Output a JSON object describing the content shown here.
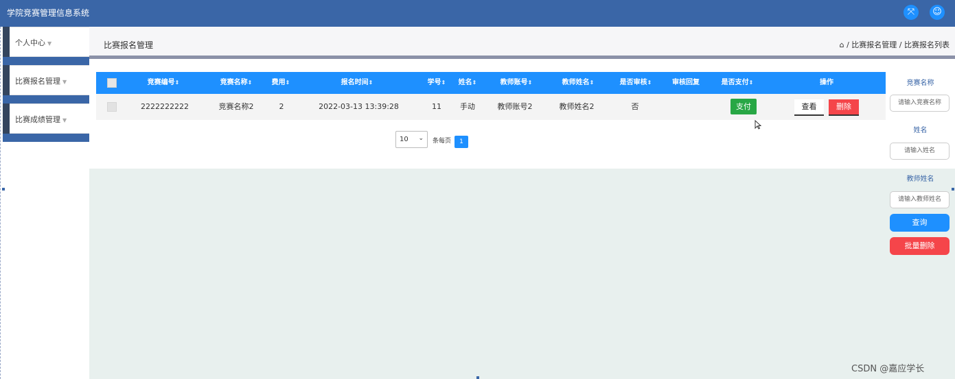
{
  "app": {
    "title": "学院竞赛管理信息系统"
  },
  "sidebar": {
    "items": [
      {
        "label": "个人中心"
      },
      {
        "label": "比赛报名管理"
      },
      {
        "label": "比赛成绩管理"
      }
    ]
  },
  "header": {
    "page_title": "比赛报名管理",
    "breadcrumb": [
      "比赛报名管理",
      "比赛报名列表"
    ]
  },
  "table": {
    "columns": [
      "竞赛编号",
      "竞赛名称",
      "费用",
      "报名时间",
      "学号",
      "姓名",
      "教师账号",
      "教师姓名",
      "是否审核",
      "审核回复",
      "是否支付",
      "操作"
    ],
    "sortable": [
      true,
      true,
      true,
      true,
      true,
      true,
      true,
      true,
      true,
      false,
      true,
      false
    ],
    "rows": [
      {
        "competition_no": "2222222222",
        "competition_name": "竞赛名称2",
        "fee": "2",
        "signup_time": "2022-03-13 13:39:28",
        "student_no": "11",
        "name": "手动",
        "teacher_account": "教师账号2",
        "teacher_name": "教师姓名2",
        "audited": "否",
        "audit_reply": "",
        "pay_label": "支付",
        "view_label": "查看",
        "delete_label": "删除"
      }
    ]
  },
  "pagination": {
    "page_size": "10",
    "per_page_label": "条每页",
    "current_page": "1"
  },
  "search": {
    "fields": [
      {
        "label": "竞赛名称",
        "placeholder": "请输入竞赛名称"
      },
      {
        "label": "姓名",
        "placeholder": "请输入姓名"
      },
      {
        "label": "教师姓名",
        "placeholder": "请输入教师姓名"
      }
    ],
    "query_label": "查询",
    "batch_delete_label": "批量删除"
  },
  "watermark": "CSDN @嘉应学长",
  "colors": {
    "primary": "#3a66a7",
    "accent": "#1e90ff",
    "success": "#28a745",
    "danger": "#f5454a",
    "content_bg": "#e8f0ee"
  }
}
